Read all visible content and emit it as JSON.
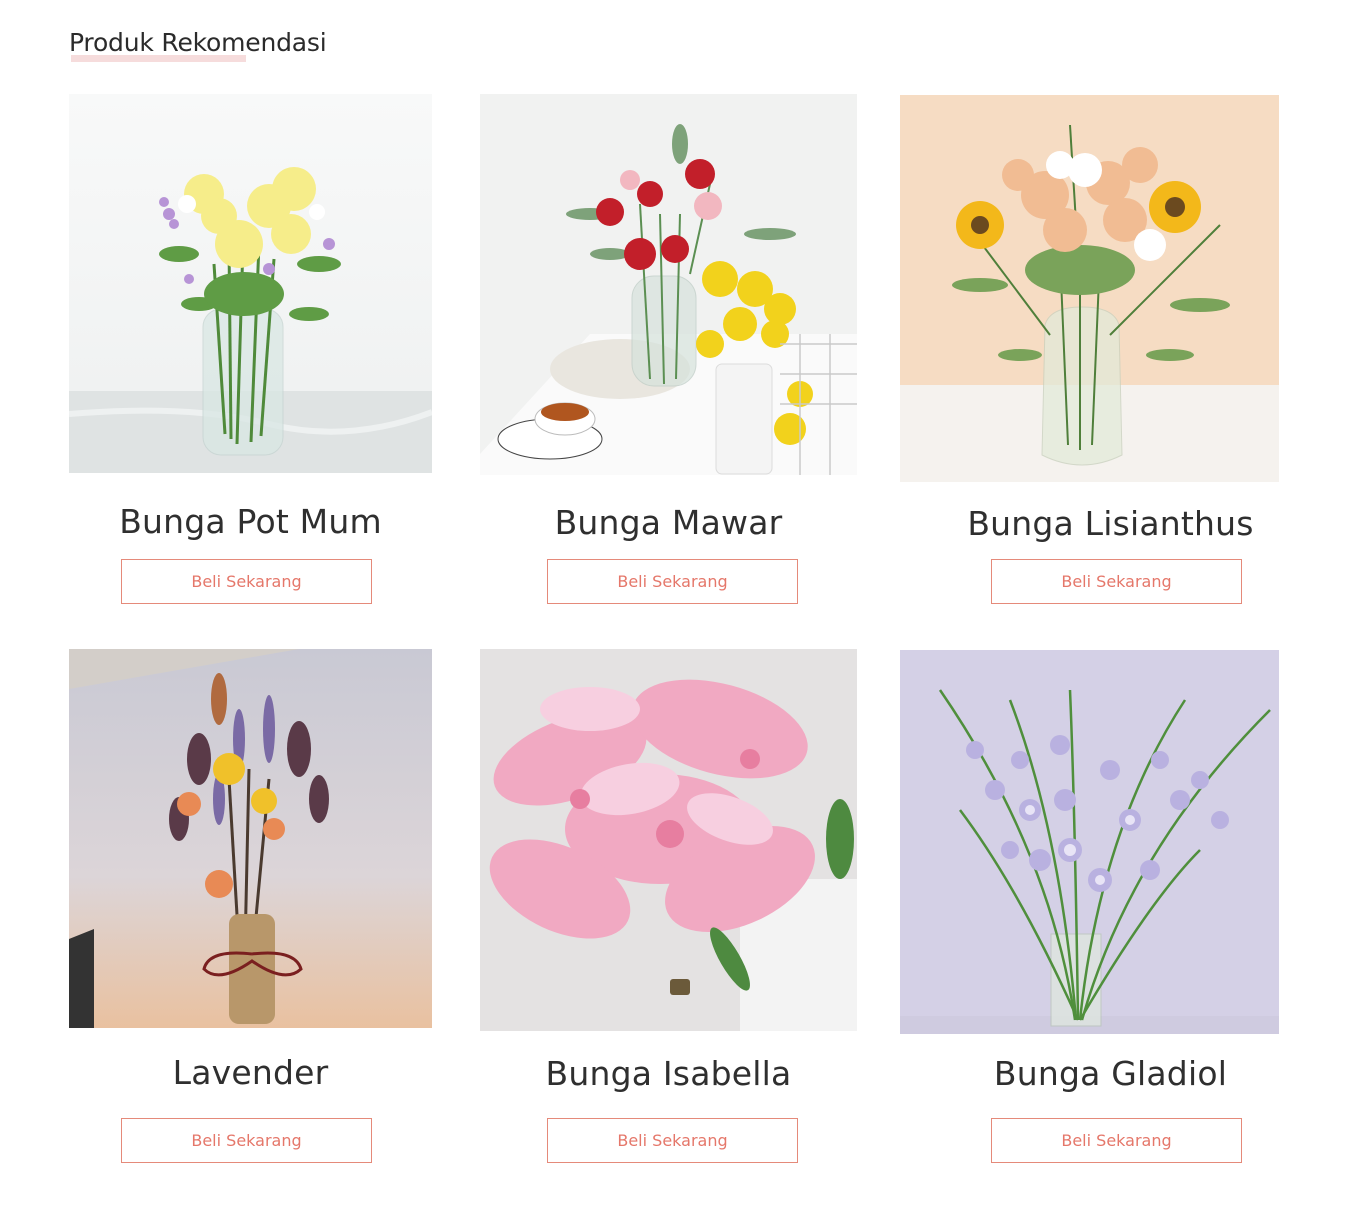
{
  "section": {
    "title": "Produk Rekomendasi"
  },
  "products": [
    {
      "name": "Bunga Pot Mum",
      "button_label": "Beli Sekarang",
      "image": "yellow-carnation-bouquet-in-glass-vase"
    },
    {
      "name": "Bunga Mawar",
      "button_label": "Beli Sekarang",
      "image": "red-and-yellow-roses-with-tea-cup"
    },
    {
      "name": "Bunga Lisianthus",
      "button_label": "Beli Sekarang",
      "image": "peach-roses-and-sunflowers-in-vase"
    },
    {
      "name": "Lavender",
      "button_label": "Beli Sekarang",
      "image": "dried-flower-bouquet-with-burlap-wrap"
    },
    {
      "name": "Bunga Isabella",
      "button_label": "Beli Sekarang",
      "image": "pink-lilies-closeup"
    },
    {
      "name": "Bunga Gladiol",
      "button_label": "Beli Sekarang",
      "image": "lilac-gladiolus-in-glass-vase"
    }
  ],
  "colors": {
    "accent": "#e5776a",
    "border": "#e58a7a",
    "title_underline": "#f6dcdc",
    "text": "#2f2f2f"
  }
}
